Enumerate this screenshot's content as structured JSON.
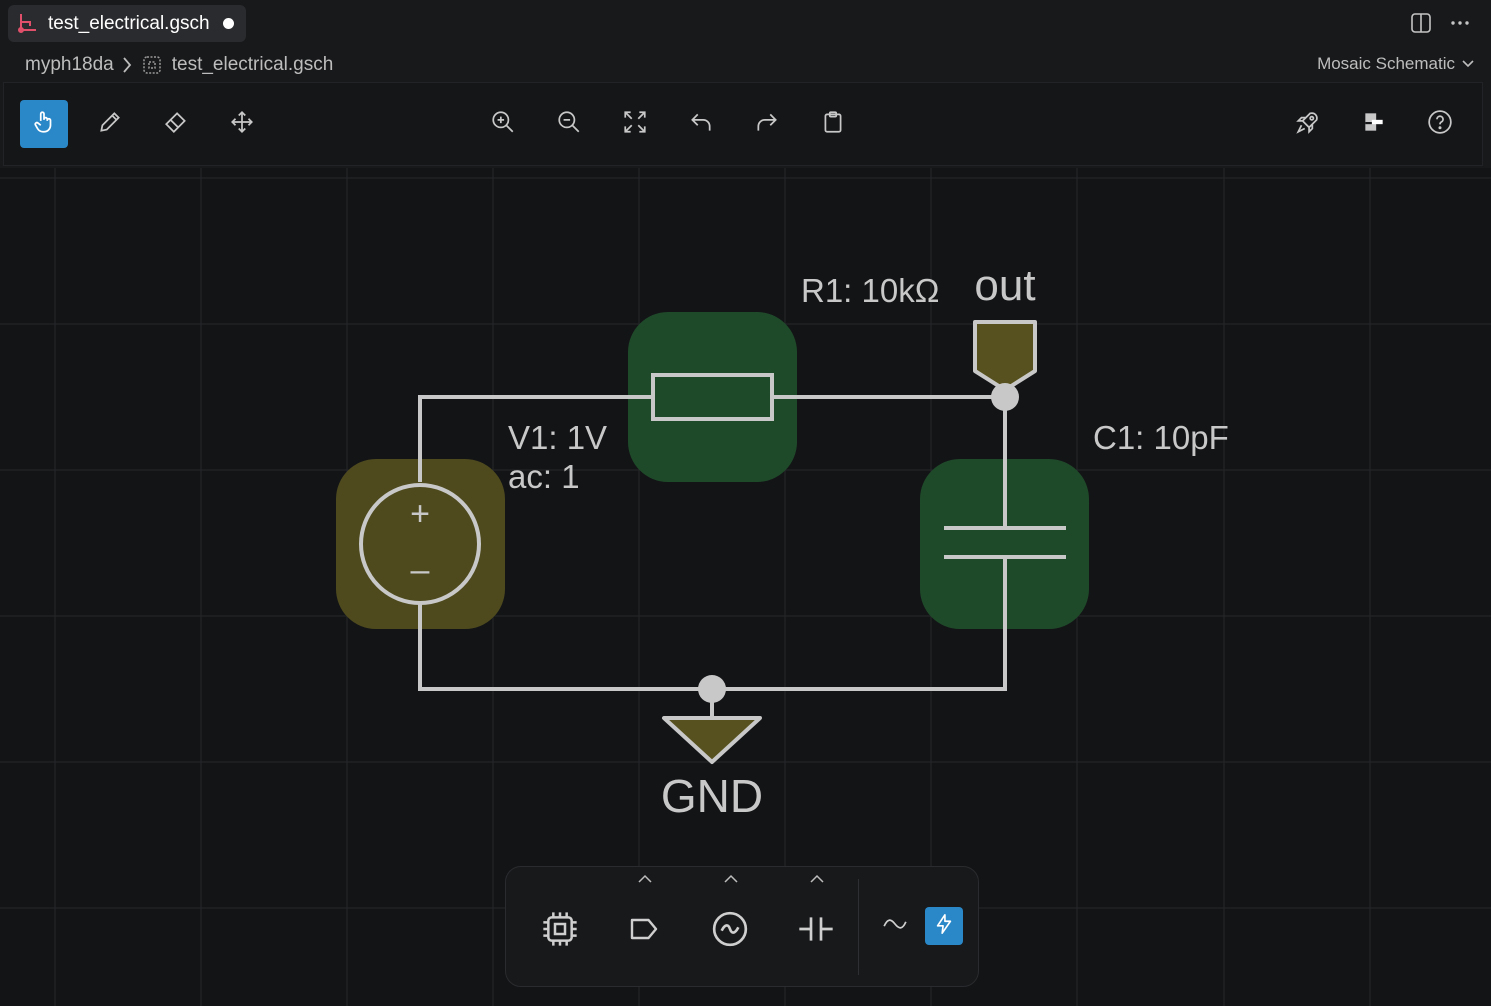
{
  "tab": {
    "title": "test_electrical.gsch",
    "dirty": true,
    "icon": "branch-icon"
  },
  "breadcrumb": {
    "root": "myph18da",
    "file": "test_electrical.gsch"
  },
  "view_select": {
    "value": "Mosaic Schematic"
  },
  "toolbar": {
    "left": [
      "pointer-hand-icon",
      "pencil-icon",
      "eraser-icon",
      "move-arrows-icon"
    ],
    "middle": [
      "zoom-in-icon",
      "zoom-out-icon",
      "fit-view-icon",
      "undo-icon",
      "redo-icon",
      "clipboard-icon"
    ],
    "right": [
      "rocket-icon",
      "netlist-icon",
      "help-icon"
    ],
    "active_tool": "pointer-hand-icon"
  },
  "schematic": {
    "resistor_label": "R1: 10kΩ",
    "out_label": "out",
    "source_label_line1": "V1: 1V",
    "source_label_line2": "ac: 1",
    "capacitor_label": "C1: 10pF",
    "ground_label": "GND",
    "source_plus": "+",
    "source_minus": "–",
    "colors": {
      "component_green": "#1f4a2a",
      "source_olive": "#4e4a1e",
      "port_olive": "#56511e",
      "wire": "#c8c8c8",
      "grid": "#25272a"
    }
  },
  "palette": {
    "items": [
      "chip-icon",
      "port-tag-icon",
      "ac-source-icon",
      "capacitor-icon"
    ],
    "mini": [
      "ac-wave-icon",
      "lightning-icon"
    ],
    "active_mini": "lightning-icon"
  }
}
